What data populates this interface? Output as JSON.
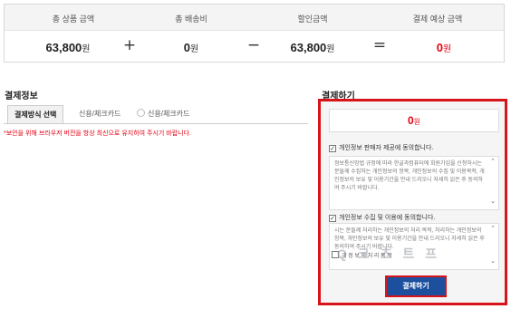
{
  "summary": {
    "headers": [
      "총 상품 금액",
      "총 배송비",
      "할인금액",
      "결제 예상 금액"
    ],
    "values": [
      {
        "amount": "63,800",
        "unit": "원"
      },
      {
        "amount": "0",
        "unit": "원"
      },
      {
        "amount": "63,800",
        "unit": "원"
      },
      {
        "amount": "0",
        "unit": "원"
      }
    ],
    "operators": [
      "+",
      "−",
      "="
    ],
    "accent_color": "#e60012"
  },
  "payment_info": {
    "title": "결제정보",
    "tabs": [
      "결제방식 선택",
      "신용/체크카드",
      "신용/체크카드"
    ],
    "notice": "*보안을 위해 브라우저 버전을 항상 최신으로 유지하여 주시기 바랍니다."
  },
  "checkout": {
    "title": "결제하기",
    "total_amount": "0",
    "total_unit": "원",
    "agree1_label": "개인정보 판매자 제공에 동의합니다.",
    "terms1": "정보통신망법 규정에 따라 한글과컴퓨터에 회원가입을 신청하시는 분들께 수집하는 개인정보의 항목, 개인정보의 수집 및 이용목적, 개인정보의 보유 및 이용기간을 안내 드리오니 자세히 읽은 후 동의하여 주시기 바랍니다.",
    "agree2_label": "개인정보 수집 및 이용에 동의합니다.",
    "terms2": "시는 문들께 처리하는 개인정보의 처리 목적, 처리하는 개인정보의 항목, 개인정보의 보유 및 이용기간을 안내 드리오니 자세히 읽은 후 동의하여 주시기 바랍니다.",
    "option_label": "개 정 보 의 처 리 목 적",
    "pay_button": "결제하기",
    "watermark": "Q 크 츠 트 프",
    "border_color": "#d7141a",
    "button_color": "#1d4f9f"
  }
}
